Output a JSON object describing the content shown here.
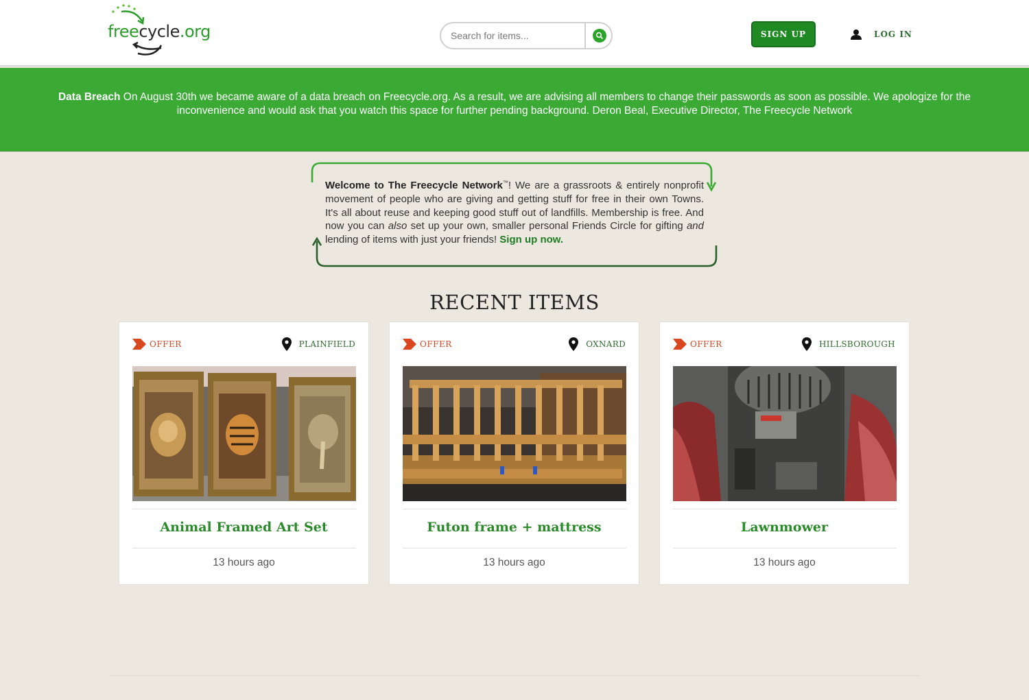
{
  "header": {
    "logo_text": {
      "free": "free",
      "cycle": "cycle",
      "org": ".org"
    },
    "search_placeholder": "Search for items...",
    "signup_label": "SIGN UP",
    "login_label": "LOG IN"
  },
  "banner": {
    "title": "Data Breach",
    "message": "On August 30th we became aware of a data breach on Freecycle.org. As a result, we are advising all members to change their passwords as soon as possible. We apologize for the inconvenience and would ask that you watch this space for further pending background. Deron Beal, Executive Director, The Freecycle Network"
  },
  "welcome": {
    "title": "Welcome to The Freecycle Network",
    "tm": "™",
    "text1": "! We are a grassroots & entirely nonprofit movement of people who are giving and getting stuff for free in their own Towns. It's all about reuse and keeping good stuff out of landfills. Membership is free. And now you can ",
    "also": "also",
    "text2": " set up your own, smaller personal Friends Circle for gifting ",
    "and": "and",
    "text3": " lending of items with just your friends! ",
    "signup_link": "Sign up now."
  },
  "recent": {
    "title": "RECENT ITEMS",
    "items": [
      {
        "type": "OFFER",
        "location": "PLAINFIELD",
        "title": "Animal Framed Art Set",
        "time": "13 hours ago"
      },
      {
        "type": "OFFER",
        "location": "OXNARD",
        "title": "Futon frame + mattress",
        "time": "13 hours ago"
      },
      {
        "type": "OFFER",
        "location": "HILLSBOROUGH...",
        "title": "Lawnmower",
        "time": "13 hours ago"
      }
    ]
  },
  "colors": {
    "brand_green": "#3aaa35",
    "button_green": "#1f8a24",
    "offer_orange": "#d9471f",
    "title_green": "#2a8a2a"
  },
  "icons": {
    "search": "search-icon",
    "user": "user-icon",
    "offer": "offer-tag-icon",
    "location": "location-pin-icon"
  }
}
